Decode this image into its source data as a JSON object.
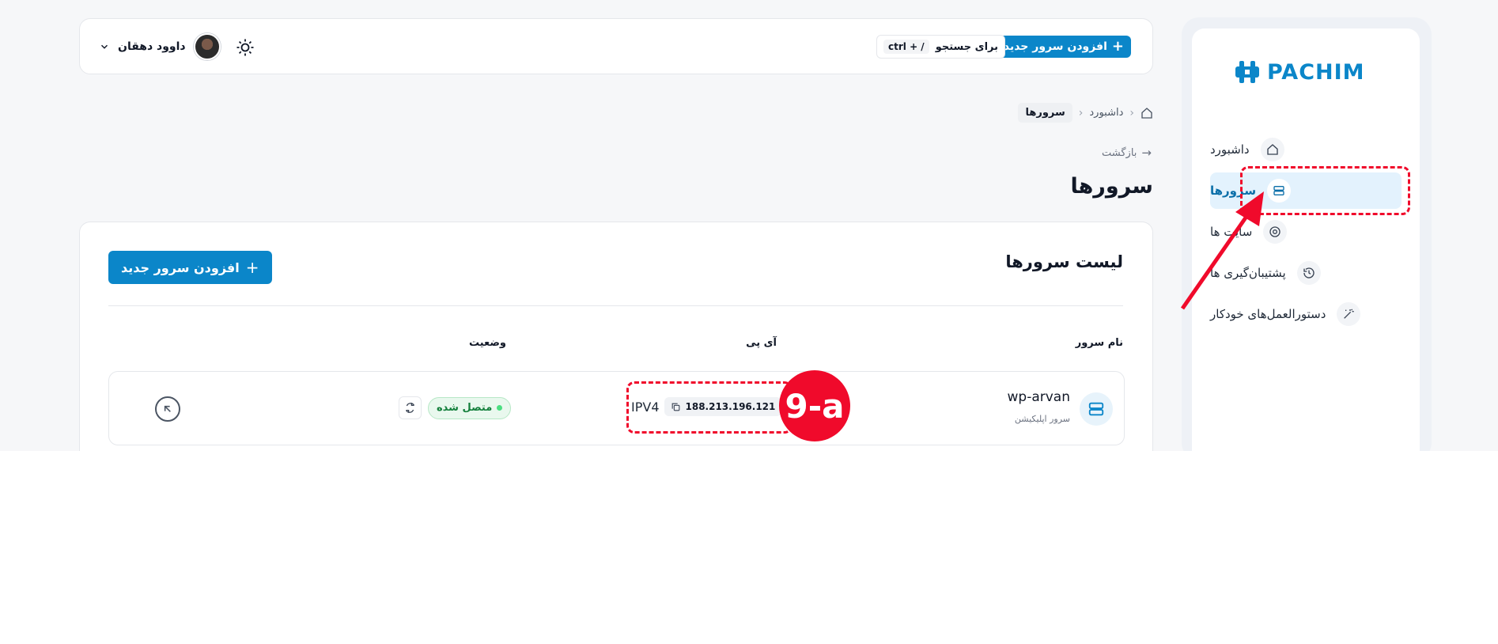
{
  "brand": {
    "name": "PACHIM",
    "color": "#0b86c9"
  },
  "sidebar": {
    "items": [
      {
        "label": "داشبورد",
        "icon": "home-icon"
      },
      {
        "label": "سرورها",
        "icon": "server-icon",
        "active": true
      },
      {
        "label": "سایت ها",
        "icon": "chrome-icon"
      },
      {
        "label": "پشتیبان‌گیری ها",
        "icon": "history-icon"
      },
      {
        "label": "دستورالعمل‌های خودکار",
        "icon": "magic-wand-icon"
      }
    ]
  },
  "header": {
    "add_server_label": "افزودن سرور جدید",
    "search_label": "برای جستجو",
    "search_shortcut": "ctrl + /",
    "user_name": "داوود دهقان",
    "theme_icon": "sun-icon"
  },
  "breadcrumb": {
    "home_icon": "home-icon",
    "items": [
      "داشبورد",
      "سرورها"
    ]
  },
  "back_label": "بازگشت",
  "page_title": "سرورها",
  "servers_card": {
    "title": "لیست سرورها",
    "add_button_label": "افزودن سرور جدید",
    "columns": [
      "نام سرور",
      "آی پی",
      "وضعیت"
    ],
    "rows": [
      {
        "name": "wp-arvan",
        "type": "سرور اپلیکیشن",
        "ip_protocol": "IPV4",
        "ip": "188.213.196.121",
        "status": "متصل شده",
        "status_color": "#15803d"
      }
    ]
  },
  "annotation": {
    "step_label": "9-a",
    "color": "#f00a2b"
  }
}
